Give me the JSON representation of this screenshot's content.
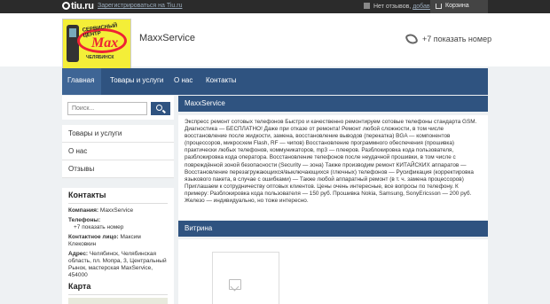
{
  "topbar": {
    "logo": "tiu.ru",
    "register_link": "Зарегистрироваться на Tiu.ru",
    "favorites_prefix": "Нет отзывов,",
    "favorites_link": "добавить",
    "cart_label": "Корзина"
  },
  "header": {
    "company_name": "MaxxService",
    "phone_label": "+7 показать номер",
    "logo": {
      "top_text": "СЕРВИСНЫЙ ЦЕНТР",
      "brand": "Max",
      "bottom_text": "ЧЕЛЯБИНСК"
    }
  },
  "nav": {
    "items": [
      {
        "label": "Главная"
      },
      {
        "label": "Товары и услуги"
      },
      {
        "label": "О нас"
      },
      {
        "label": "Контакты"
      }
    ]
  },
  "search": {
    "placeholder": "Поиск..."
  },
  "sidebar": {
    "items": [
      {
        "label": "Товары и услуги"
      },
      {
        "label": "О нас"
      },
      {
        "label": "Отзывы"
      }
    ]
  },
  "contacts": {
    "title": "Контакты",
    "company_label": "Компания:",
    "company_value": "MaxxService",
    "phones_label": "Телефоны:",
    "phone_value": "+7 показать номер",
    "person_label": "Контактное лицо:",
    "person_value": "Максим Клековкин",
    "address_label": "Адрес:",
    "address_value": "Челябинск, Челябинская область, пл. Мопра, 3, Центральный Рынок, мастерская MaxService, 454000"
  },
  "map": {
    "title": "Карта"
  },
  "main": {
    "title": "MaxxService",
    "description": "Экспресс ремонт сотовых телефонов Быстро и качественно ремонтируем сотовые телефоны стандарта GSM. Диагностика — БЕСПЛАТНО! Даже при отказе от ремонта! Ремонт любой сложности, в том числе восстановление после жидкости, замена, восстановление выводов (перекатка) BGA — компонентов (процессоров, микросхем Flash, RF — чипов) Восстановление программного обеспечения (прошивка) практически любых телефонов, коммуникаторов, mp3 — плееров. Разблокировка кода пользователя, разблокировка кода оператора. Восстановление телефонов после неудачной прошивки, в том числе с повреждённой зоной безопасности (Security — зона) Также производим ремонт КИТАЙСКИХ аппаратов — Восстановление перезагружающихся/выключающихся (глючных) телефонов — Русификация (корректировка языкового пакета, в случае с ошибками) — Также любой аппаратный ремонт (в т. ч. замена процессоров) Приглашаем к сотрудничеству оптовых клиентов. Цены очень интересные, все вопросы по телефону. К примеру: Разблокировка кода пользователя — 150 руб. Прошивка Nokia, Samsung, SonyEricsson — 200 руб. Железо — индивидуально, но тоже интересно.",
    "showcase_title": "Витрина"
  }
}
